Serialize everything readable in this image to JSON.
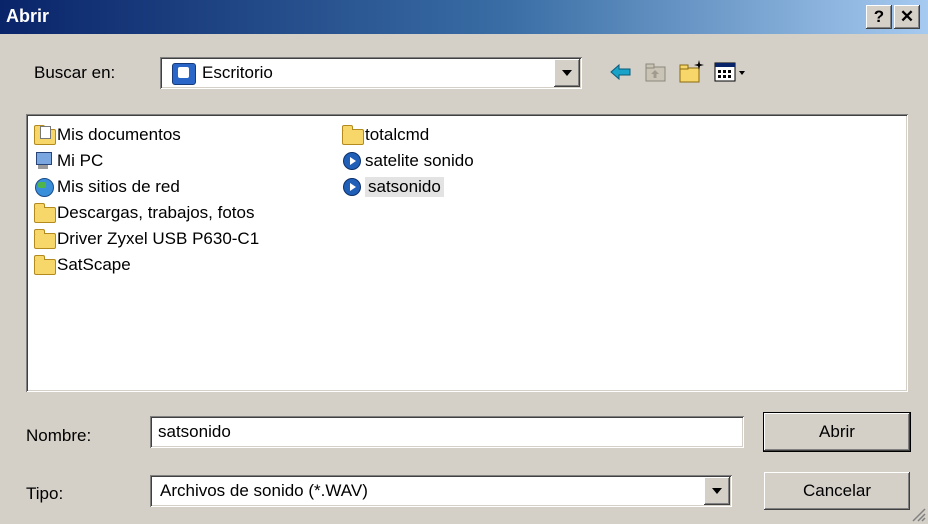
{
  "window": {
    "title": "Abrir",
    "help_button": "?",
    "close_button": "✕"
  },
  "lookin": {
    "label": "Buscar en:",
    "value": "Escritorio"
  },
  "toolbar": {
    "back_icon": "back-arrow-icon",
    "up_icon": "up-folder-icon",
    "new_folder_icon": "new-folder-icon",
    "view_icon": "view-menu-icon"
  },
  "files": {
    "col1": [
      {
        "label": "Mis documentos",
        "icon": "my-documents-icon"
      },
      {
        "label": "Mi PC",
        "icon": "my-computer-icon"
      },
      {
        "label": "Mis sitios de red",
        "icon": "network-places-icon"
      },
      {
        "label": "Descargas, trabajos, fotos",
        "icon": "folder-icon"
      },
      {
        "label": "Driver Zyxel USB P630-C1",
        "icon": "folder-icon"
      },
      {
        "label": "SatScape",
        "icon": "folder-icon"
      }
    ],
    "col2": [
      {
        "label": "totalcmd",
        "icon": "folder-icon"
      },
      {
        "label": "satelite sonido",
        "icon": "audio-file-icon"
      },
      {
        "label": "satsonido",
        "icon": "audio-file-icon",
        "selected": true
      }
    ]
  },
  "filename": {
    "label": "Nombre:",
    "value": "satsonido"
  },
  "filetype": {
    "label": "Tipo:",
    "value": "Archivos de sonido (*.WAV)"
  },
  "buttons": {
    "open": "Abrir",
    "cancel": "Cancelar"
  },
  "colors": {
    "title_gradient_start": "#0a246a",
    "title_gradient_end": "#a6caf0",
    "face": "#d4d0c8"
  }
}
